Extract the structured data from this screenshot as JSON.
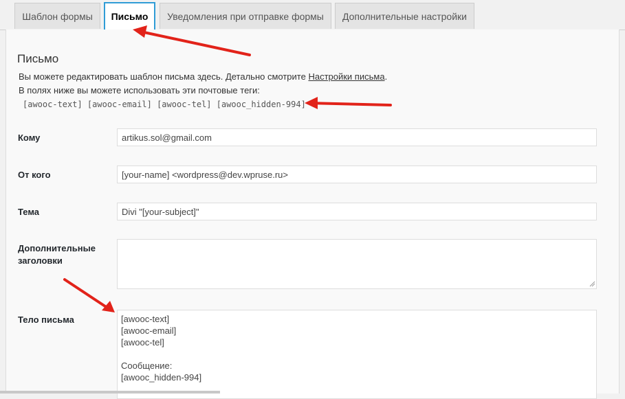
{
  "tabs": [
    {
      "label": "Шаблон формы",
      "active": false
    },
    {
      "label": "Письмо",
      "active": true
    },
    {
      "label": "Уведомления при отправке формы",
      "active": false
    },
    {
      "label": "Дополнительные настройки",
      "active": false
    }
  ],
  "section": {
    "title": "Письмо",
    "desc_line1_prefix": "Вы можете редактировать шаблон письма здесь. Детально смотрите ",
    "desc_link": "Настройки письма",
    "desc_line1_suffix": ".",
    "desc_line2": "В полях ниже вы можете использовать эти почтовые теги:",
    "tags": "[awooc-text] [awooc-email] [awooc-tel] [awooc_hidden-994]"
  },
  "fields": {
    "to": {
      "label": "Кому",
      "value": "artikus.sol@gmail.com"
    },
    "from": {
      "label": "От кого",
      "value": "[your-name] <wordpress@dev.wpruse.ru>"
    },
    "subject": {
      "label": "Тема",
      "value": "Divi \"[your-subject]\""
    },
    "headers": {
      "label": "Дополнительные заголовки",
      "value": ""
    },
    "body": {
      "label": "Тело письма",
      "value": "[awooc-text]\n[awooc-email]\n[awooc-tel]\n\nСообщение:\n[awooc_hidden-994]"
    }
  },
  "colors": {
    "active_tab_border": "#2f9cd6",
    "annotation_arrow": "#e2231a"
  },
  "icons": [
    "resize-grip-icon"
  ]
}
